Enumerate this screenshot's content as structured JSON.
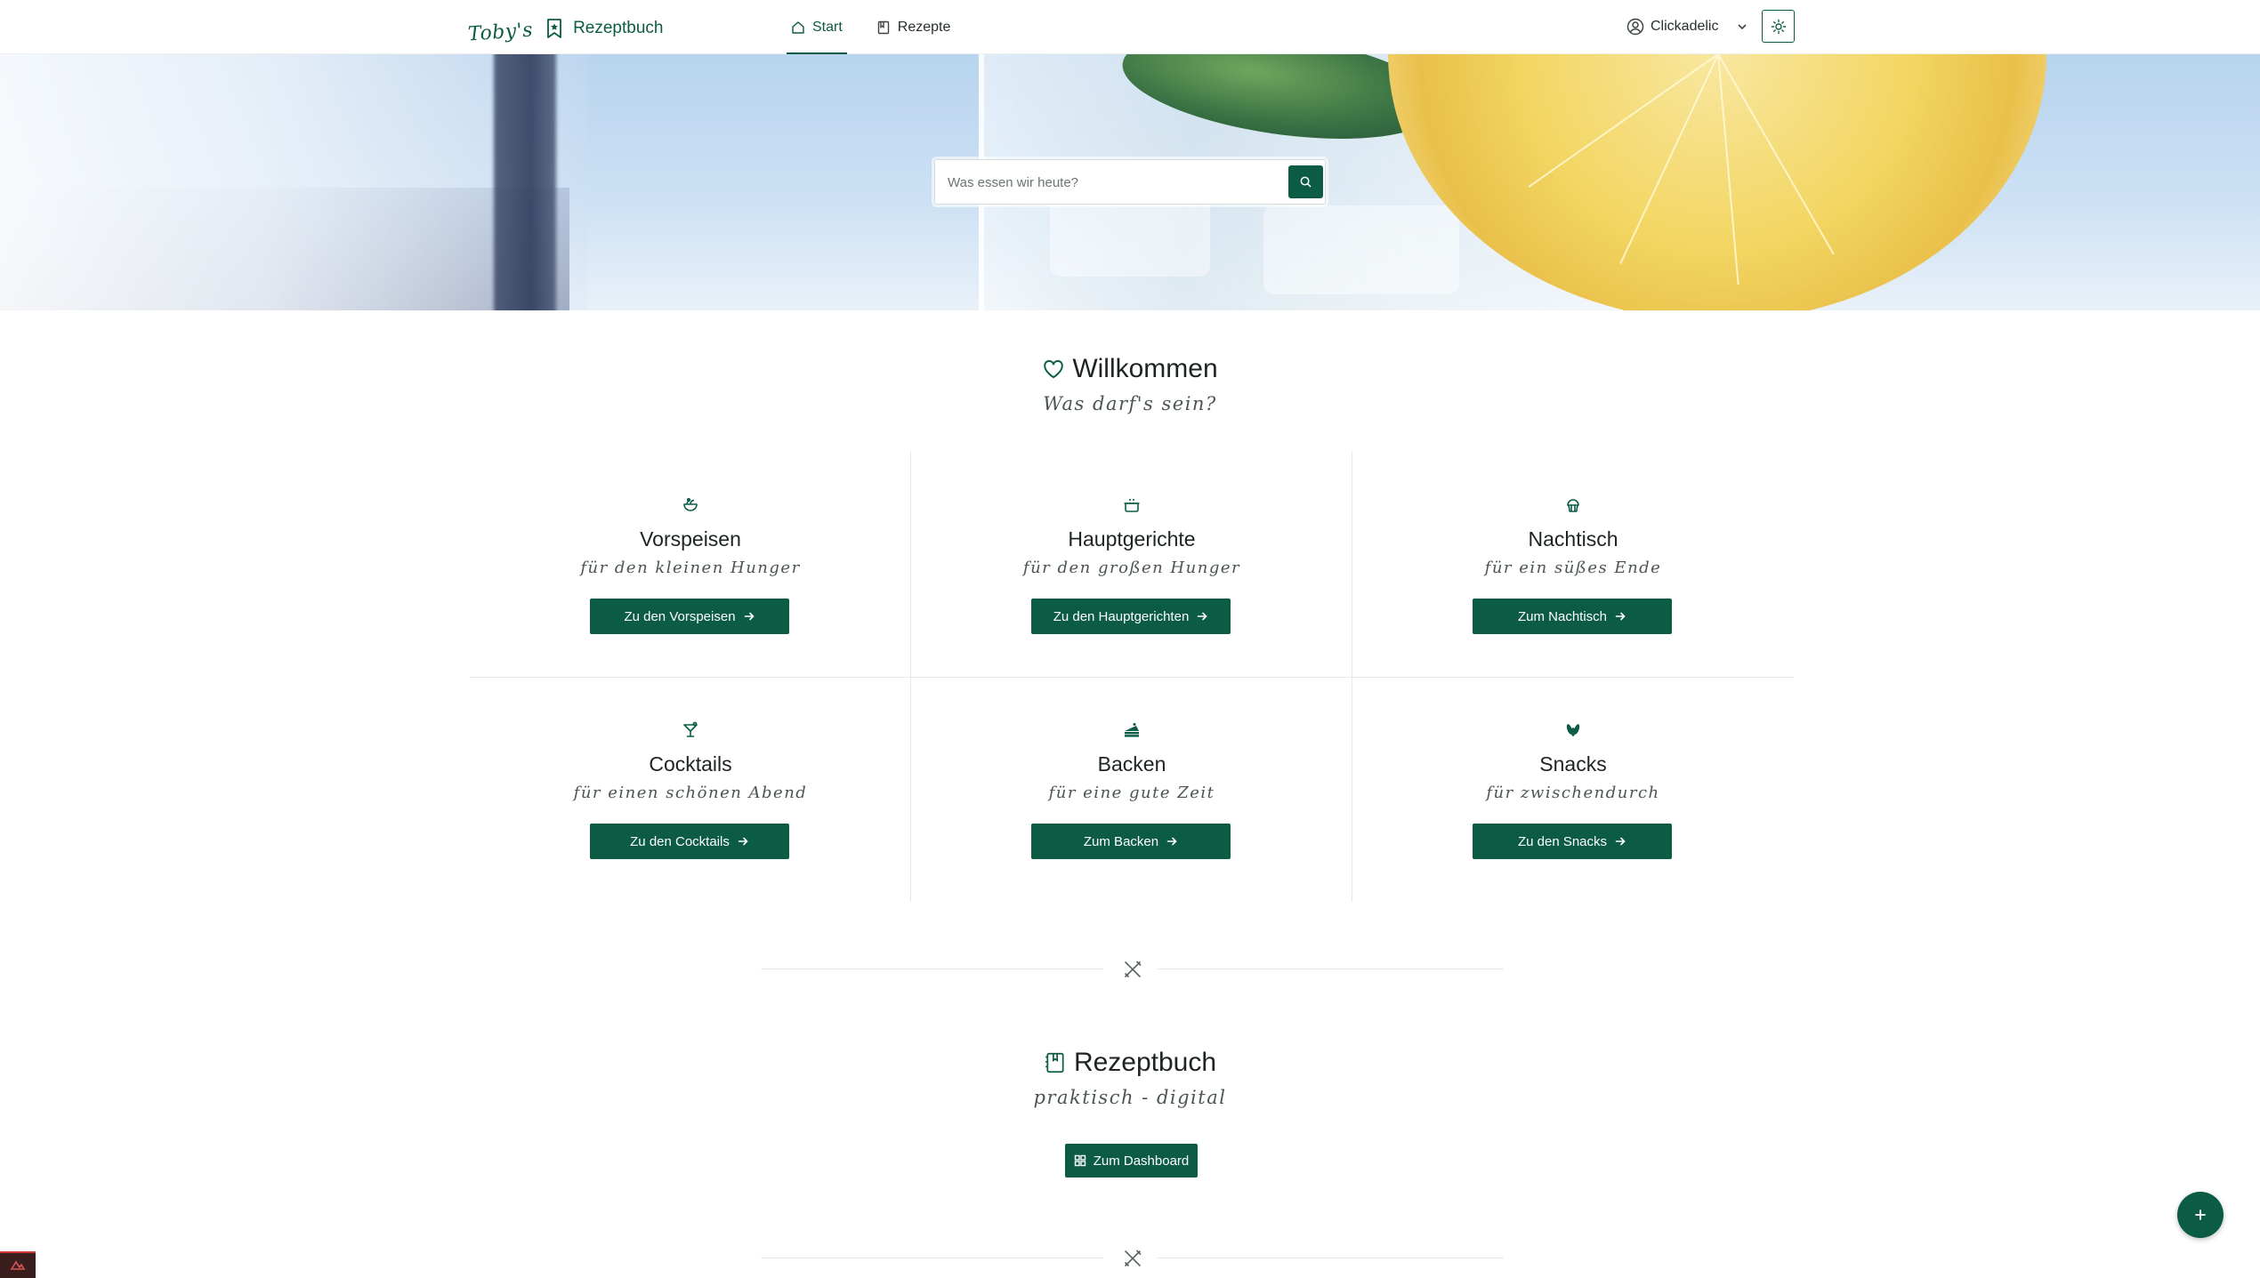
{
  "header": {
    "brand_script": "Toby's",
    "brand_name": "Rezeptbuch",
    "nav": [
      {
        "label": "Start",
        "icon": "home-icon",
        "active": true
      },
      {
        "label": "Rezepte",
        "icon": "book-icon",
        "active": false
      }
    ],
    "user_name": "Clickadelic",
    "theme_icon": "sun-icon"
  },
  "search": {
    "placeholder": "Was essen wir heute?",
    "value": "",
    "icon": "search-icon"
  },
  "welcome": {
    "title": "Willkommen",
    "subtitle": "Was darf's sein?",
    "icon": "heart-icon"
  },
  "categories": [
    {
      "title": "Vorspeisen",
      "subtitle": "für den kleinen Hunger",
      "button": "Zu den Vorspeisen",
      "icon": "salad-icon"
    },
    {
      "title": "Hauptgerichte",
      "subtitle": "für den großen Hunger",
      "button": "Zu den Hauptgerichten",
      "icon": "pot-icon"
    },
    {
      "title": "Nachtisch",
      "subtitle": "für ein süßes Ende",
      "button": "Zum Nachtisch",
      "icon": "muffin-icon"
    },
    {
      "title": "Cocktails",
      "subtitle": "für einen schönen Abend",
      "button": "Zu den Cocktails",
      "icon": "cocktail-icon"
    },
    {
      "title": "Backen",
      "subtitle": "für eine gute Zeit",
      "button": "Zum Backen",
      "icon": "cake-icon"
    },
    {
      "title": "Snacks",
      "subtitle": "für zwischendurch",
      "button": "Zu den Snacks",
      "icon": "nuts-icon"
    }
  ],
  "rezeptbuch": {
    "title": "Rezeptbuch",
    "subtitle": "praktisch - digital",
    "button": "Zum Dashboard",
    "icon": "book-icon"
  },
  "colors": {
    "accent": "#0b5b45",
    "text": "#1d2421"
  }
}
